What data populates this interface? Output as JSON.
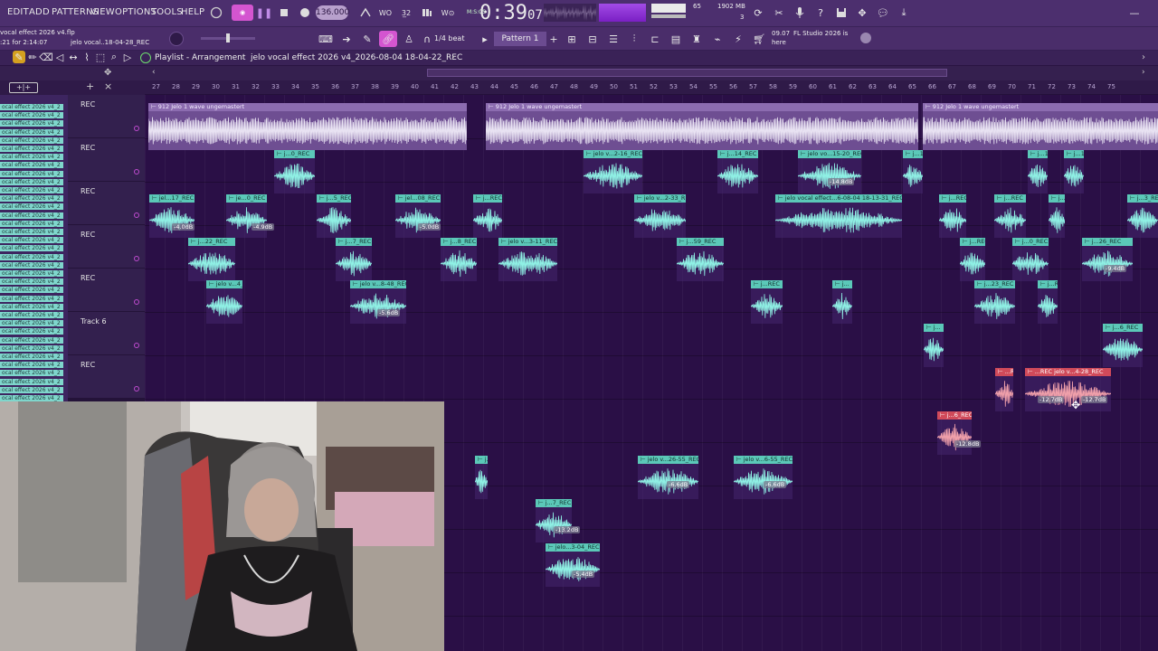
{
  "menu": [
    "EDIT",
    "ADD",
    "PATTERNS",
    "VIEW",
    "OPTIONS",
    "TOOLS",
    "HELP"
  ],
  "transport": {
    "tempo": "136.000",
    "time": "0:39",
    "time_frac": "07",
    "time_mode": "M:S:CS"
  },
  "cpu": {
    "top": "65",
    "mem": "1902 MB",
    "poly": "3"
  },
  "snap": "1/4 beat",
  "pattern": "Pattern 1",
  "hint": {
    "date": "09.07",
    "message_line1": "FL Studio 2026 is",
    "message_line2": "here"
  },
  "project": {
    "file": "vocal effect 2026 v4.flp",
    "time_line": ":21 for 2:14:07",
    "clip_hint": "jelo vocal..18-04-28_REC"
  },
  "breadcrumb": {
    "window": "Playlist - Arrangement",
    "separator": "›",
    "clip": "jelo vocal effect 2026 v4_2026-08-04 18-04-22_REC",
    "arrow": "›"
  },
  "ruler": {
    "ticks": [
      "27",
      "28",
      "29",
      "30",
      "31",
      "32",
      "33",
      "34",
      "35",
      "36",
      "37",
      "38",
      "39",
      "40",
      "41",
      "42",
      "43",
      "44",
      "45",
      "46",
      "47",
      "48",
      "49",
      "50",
      "51",
      "52",
      "53",
      "54",
      "55",
      "56",
      "57",
      "58",
      "59",
      "60",
      "61",
      "62",
      "63",
      "64",
      "65",
      "66",
      "67",
      "68",
      "69",
      "70",
      "71",
      "72",
      "73",
      "74",
      "75"
    ]
  },
  "tracks": [
    {
      "label": "REC"
    },
    {
      "label": "REC"
    },
    {
      "label": "REC"
    },
    {
      "label": "REC"
    },
    {
      "label": "REC"
    },
    {
      "label": "Track 6"
    },
    {
      "label": "REC"
    }
  ],
  "channels": [
    "ocal effect 2026 v4_2",
    "ocal effect 2026 v4_2",
    "ocal effect 2026 v4_2",
    "ocal effect 2026 v4_2",
    "ocal effect 2026 v4_2",
    "ocal effect 2026 v4_2",
    "ocal effect 2026 v4_2",
    "ocal effect 2026 v4_2",
    "ocal effect 2026 v4_2",
    "ocal effect 2026 v4_2",
    "ocal effect 2026 v4_2",
    "ocal effect 2026 v4_2",
    "ocal effect 2026 v4_2",
    "ocal effect 2026 v4_2",
    "ocal effect 2026 v4_2",
    "ocal effect 2026 v4_2",
    "ocal effect 2026 v4_2",
    "ocal effect 2026 v4_2",
    "ocal effect 2026 v4_2",
    "ocal effect 2026 v4_2",
    "ocal effect 2026 v4_2",
    "ocal effect 2026 v4_2",
    "ocal effect 2026 v4_2",
    "ocal effect 2026 v4_2",
    "ocal effect 2026 v4_2",
    "ocal effect 2026 v4_2",
    "ocal effect 2026 v4_2",
    "ocal effect 2026 v4_2",
    "ocal effect 2026 v4_2",
    "ocal effect 2026 v4_2",
    "ocal effect 2026 v4_2",
    "ocal effect 2026 v4_2",
    "ocal effect 2026 v4_2",
    "ocal effect 2026 v4_2",
    "ocal effect 2026 v4_2",
    "ocal effect 2026 v4_2"
  ],
  "clips": [
    {
      "label": "912 Jelo 1 wave ungemastert",
      "type": "master"
    },
    {
      "label": "912 Jelo 1 wave ungemastert",
      "type": "master"
    },
    {
      "label": "912 Jelo 1 wave ungemastert",
      "type": "master"
    },
    {
      "label": "j...0_REC"
    },
    {
      "label": "jelo v...2-16_REC"
    },
    {
      "label": "j...14_REC"
    },
    {
      "label": "jelo vo...15-20_REC"
    },
    {
      "label": "j...1_REC"
    },
    {
      "label": "j...1_REC"
    },
    {
      "label": "j...1_REC"
    },
    {
      "label": "jel...17_REC"
    },
    {
      "label": "je...0_REC"
    },
    {
      "label": "j...5_REC"
    },
    {
      "label": "jel...08_REC"
    },
    {
      "label": "j...REC"
    },
    {
      "label": "jelo v...2-33_REC"
    },
    {
      "label": "jelo vocal effect...6-08-04 18-13-31_REC"
    },
    {
      "label": "j...REC"
    },
    {
      "label": "j...REC"
    },
    {
      "label": "j...REC"
    },
    {
      "label": "j...3_REC"
    },
    {
      "label": "j...22_REC"
    },
    {
      "label": "j...7_REC"
    },
    {
      "label": "j...8_REC"
    },
    {
      "label": "jelo v...3-11_REC"
    },
    {
      "label": "j...59_REC"
    },
    {
      "label": "j...REC"
    },
    {
      "label": "j...0_REC"
    },
    {
      "label": "j...26_REC"
    },
    {
      "label": "jelo v...4_REC"
    },
    {
      "label": "jelo v...8-48_REC"
    },
    {
      "label": "j...REC"
    },
    {
      "label": "j..."
    },
    {
      "label": "j...23_REC"
    },
    {
      "label": "j...REC"
    },
    {
      "label": "j..."
    },
    {
      "label": "j...6_REC"
    },
    {
      "label": "...REC",
      "type": "red"
    },
    {
      "label": "...REC jelo v...4-28_REC",
      "type": "red"
    },
    {
      "label": "j...6_REC",
      "type": "red"
    },
    {
      "label": "jelo v...26-55_REC"
    },
    {
      "label": "jelo v...6-55_REC"
    },
    {
      "label": "j..."
    },
    {
      "label": "j...7_REC"
    },
    {
      "label": "jelo...3-04_REC"
    }
  ],
  "gains": [
    "-4.0dB",
    "-4.9dB",
    "-5.0dB",
    "-5.6dB",
    "-14.8dB",
    "-12.7dB",
    "-12.7dB",
    "-12.8dB",
    "-6.6dB",
    "-6.6dB",
    "-13.2dB",
    "-5.4dB",
    "-9.4dB"
  ],
  "colors": {
    "clip": "#5bc8b8",
    "wave": "#8ff0e4",
    "clip_red": "#d04a5a",
    "background": "#2a0f46",
    "accent": "#a040e0"
  }
}
